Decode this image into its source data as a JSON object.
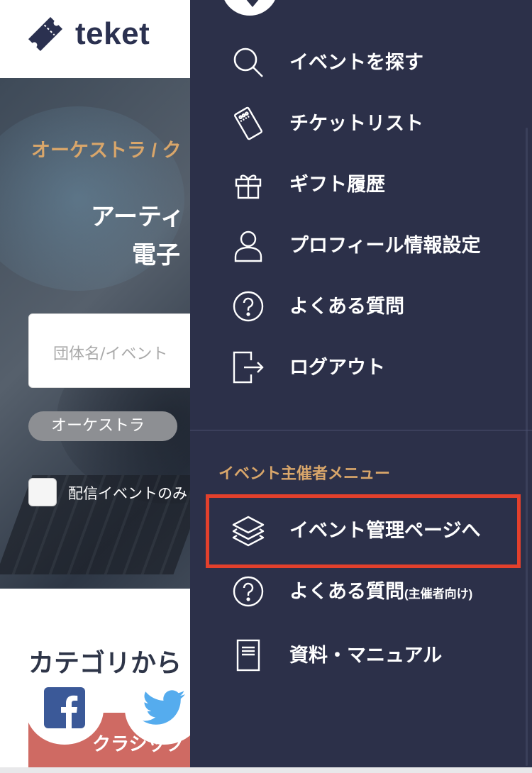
{
  "header": {
    "logo_text": "teket"
  },
  "hero": {
    "category": "オーケストラ / ク",
    "title_line1": "アーティ",
    "title_line2": "電子",
    "search_placeholder": "団体名/イベント",
    "tag": "オーケストラ",
    "checkbox_label": "配信イベントのみ"
  },
  "categories": {
    "heading": "カテゴリから",
    "card_label": "クラシック"
  },
  "social": {
    "facebook": "facebook-icon",
    "twitter": "twitter-icon"
  },
  "drawer": {
    "items": [
      {
        "label": "イベントを探す",
        "icon": "search-icon"
      },
      {
        "label": "チケットリスト",
        "icon": "ticket-icon"
      },
      {
        "label": "ギフト履歴",
        "icon": "gift-icon"
      },
      {
        "label": "プロフィール情報設定",
        "icon": "user-icon"
      },
      {
        "label": "よくある質問",
        "icon": "help-icon"
      },
      {
        "label": "ログアウト",
        "icon": "logout-icon"
      }
    ],
    "organizer_section_title": "イベント主催者メニュー",
    "organizer_items": [
      {
        "label": "イベント管理ページへ",
        "icon": "layers-icon"
      },
      {
        "label": "よくある質問",
        "sublabel": "(主催者向け)",
        "icon": "help-icon"
      },
      {
        "label": "資料・マニュアル",
        "icon": "document-icon"
      }
    ]
  },
  "colors": {
    "drawer_bg": "#2c3049",
    "accent_gold": "#d9a66a",
    "highlight_red": "#e3402c",
    "brand_navy": "#2b3150",
    "category_card": "#cf6a63"
  }
}
